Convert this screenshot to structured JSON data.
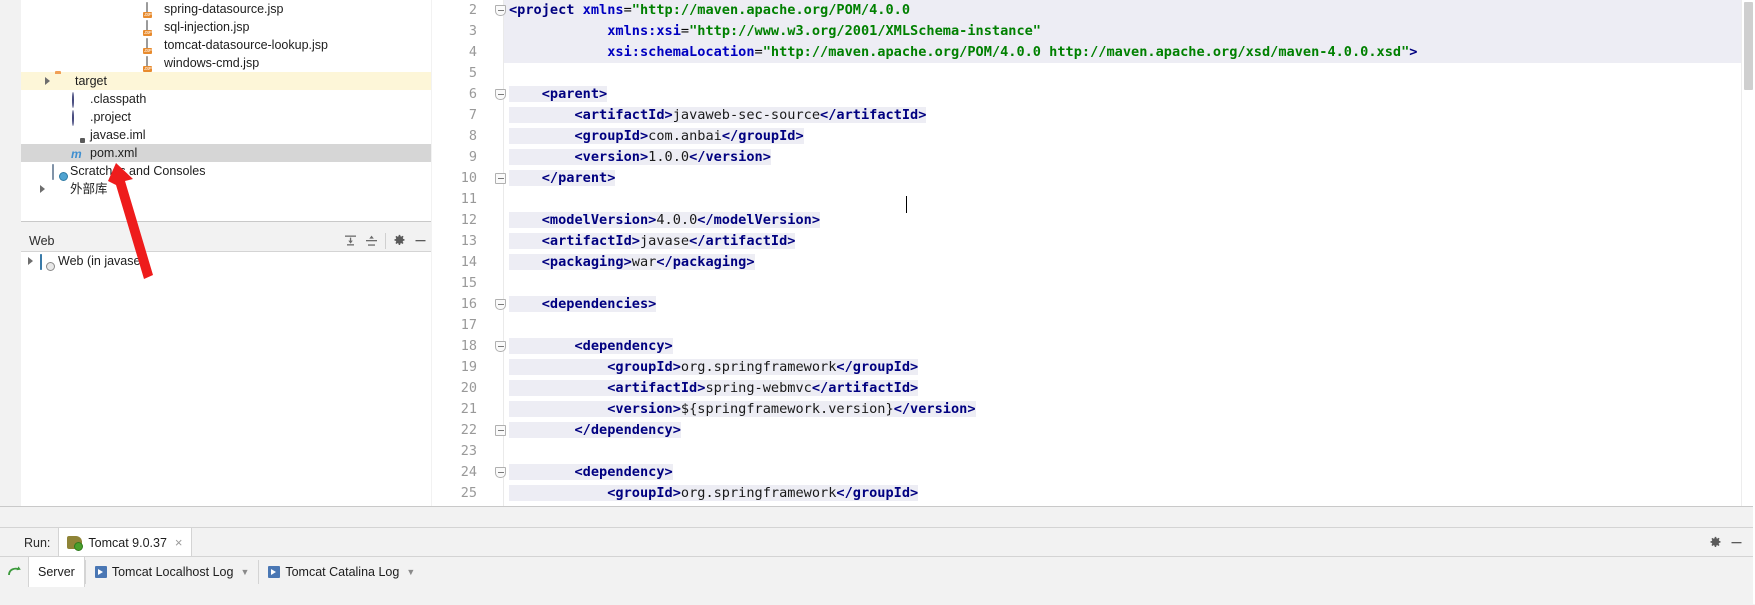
{
  "project_tree": {
    "name": "Project",
    "items": [
      {
        "label": "spring-datasource.jsp",
        "icon": "jsp-file-icon",
        "indent": 110,
        "arrow": false,
        "state": "normal"
      },
      {
        "label": "sql-injection.jsp",
        "icon": "jsp-file-icon",
        "indent": 110,
        "arrow": false,
        "state": "normal"
      },
      {
        "label": "tomcat-datasource-lookup.jsp",
        "icon": "jsp-file-icon",
        "indent": 110,
        "arrow": false,
        "state": "normal"
      },
      {
        "label": "windows-cmd.jsp",
        "icon": "jsp-file-icon",
        "indent": 110,
        "arrow": false,
        "state": "normal"
      },
      {
        "label": "target",
        "icon": "folder-icon",
        "indent": 21,
        "arrow": true,
        "state": "highlight"
      },
      {
        "label": ".classpath",
        "icon": "eclipse-file-icon",
        "indent": 36,
        "arrow": false,
        "state": "normal"
      },
      {
        "label": ".project",
        "icon": "eclipse-file-icon",
        "indent": 36,
        "arrow": false,
        "state": "normal"
      },
      {
        "label": "javase.iml",
        "icon": "module-iml-icon",
        "indent": 36,
        "arrow": false,
        "state": "normal"
      },
      {
        "label": "pom.xml",
        "icon": "maven-m-icon",
        "indent": 36,
        "arrow": false,
        "state": "selected"
      },
      {
        "label": "Scratches and Consoles",
        "icon": "scratches-icon",
        "indent": 16,
        "arrow": false,
        "state": "normal"
      },
      {
        "label": "外部库",
        "icon": "external-libraries-icon",
        "indent": 16,
        "arrow": true,
        "state": "normal"
      }
    ]
  },
  "web_panel": {
    "title": "Web",
    "actions": [
      "expand-all-icon",
      "collapse-all-icon",
      "settings-gear-icon",
      "hide-minimize-icon"
    ],
    "items": [
      {
        "label": "Web (in javase)",
        "icon": "web-module-icon",
        "arrow": true
      }
    ]
  },
  "editor": {
    "file": "pom.xml",
    "first_line_number": 2,
    "lines": [
      {
        "n": 2,
        "fold": "start",
        "selected": true,
        "html": "<span class=\"tag\">&lt;project</span> <span class=\"attr\">xmlns</span>=<span class=\"str\">\"http://maven.apache.org/POM/4.0.0</span>"
      },
      {
        "n": 3,
        "fold": "",
        "selected": true,
        "html": "            <span class=\"attr\">xmlns:xsi</span>=<span class=\"str\">\"http://www.w3.org/2001/XMLSchema-instance\"</span>"
      },
      {
        "n": 4,
        "fold": "",
        "selected": true,
        "html": "            <span class=\"attr\">xsi:schemaLocation</span>=<span class=\"str\">\"http://maven.apache.org/POM/4.0.0 http://maven.apache.org/xsd/maven-4.0.0.xsd\"</span><span class=\"tag\">&gt;</span>"
      },
      {
        "n": 5,
        "fold": "",
        "selected": false,
        "html": ""
      },
      {
        "n": 6,
        "fold": "start",
        "selected": false,
        "html": "    <span class=\"tag\">&lt;parent&gt;</span>"
      },
      {
        "n": 7,
        "fold": "",
        "selected": false,
        "html": "        <span class=\"tag\">&lt;artifactId&gt;</span><span class=\"txt\">javaweb-sec-source</span><span class=\"tag\">&lt;/artifactId&gt;</span>"
      },
      {
        "n": 8,
        "fold": "",
        "selected": false,
        "html": "        <span class=\"tag\">&lt;groupId&gt;</span><span class=\"txt\">com.anbai</span><span class=\"tag\">&lt;/groupId&gt;</span>"
      },
      {
        "n": 9,
        "fold": "",
        "selected": false,
        "html": "        <span class=\"tag\">&lt;version&gt;</span><span class=\"txt\">1.0.0</span><span class=\"tag\">&lt;/version&gt;</span>"
      },
      {
        "n": 10,
        "fold": "end",
        "selected": false,
        "html": "    <span class=\"tag\">&lt;/parent&gt;</span>"
      },
      {
        "n": 11,
        "fold": "",
        "selected": false,
        "html": ""
      },
      {
        "n": 12,
        "fold": "",
        "selected": false,
        "html": "    <span class=\"tag\">&lt;modelVersion&gt;</span><span class=\"txt\">4.0.0</span><span class=\"tag\">&lt;/modelVersion&gt;</span>"
      },
      {
        "n": 13,
        "fold": "",
        "selected": false,
        "html": "    <span class=\"tag\">&lt;artifactId&gt;</span><span class=\"txt\">javase</span><span class=\"tag\">&lt;/artifactId&gt;</span>"
      },
      {
        "n": 14,
        "fold": "",
        "selected": false,
        "html": "    <span class=\"tag\">&lt;packaging&gt;</span><span class=\"txt\">war</span><span class=\"tag\">&lt;/packaging&gt;</span>"
      },
      {
        "n": 15,
        "fold": "",
        "selected": false,
        "html": ""
      },
      {
        "n": 16,
        "fold": "start",
        "selected": false,
        "html": "    <span class=\"tag\">&lt;dependencies&gt;</span>"
      },
      {
        "n": 17,
        "fold": "",
        "selected": false,
        "html": ""
      },
      {
        "n": 18,
        "fold": "start",
        "selected": false,
        "html": "        <span class=\"tag\">&lt;dependency&gt;</span>"
      },
      {
        "n": 19,
        "fold": "",
        "selected": false,
        "html": "            <span class=\"tag\">&lt;groupId&gt;</span><span class=\"txt\">org.springframework</span><span class=\"tag\">&lt;/groupId&gt;</span>"
      },
      {
        "n": 20,
        "fold": "",
        "selected": false,
        "html": "            <span class=\"tag\">&lt;artifactId&gt;</span><span class=\"txt\">spring-webmvc</span><span class=\"tag\">&lt;/artifactId&gt;</span>"
      },
      {
        "n": 21,
        "fold": "",
        "selected": false,
        "html": "            <span class=\"tag\">&lt;version&gt;</span><span class=\"txt\">${springframework.version}</span><span class=\"tag\">&lt;/version&gt;</span>"
      },
      {
        "n": 22,
        "fold": "end",
        "selected": false,
        "html": "        <span class=\"tag\">&lt;/dependency&gt;</span>"
      },
      {
        "n": 23,
        "fold": "",
        "selected": false,
        "html": ""
      },
      {
        "n": 24,
        "fold": "start",
        "selected": false,
        "html": "        <span class=\"tag\">&lt;dependency&gt;</span>"
      },
      {
        "n": 25,
        "fold": "",
        "selected": false,
        "html": "            <span class=\"tag\">&lt;groupId&gt;</span><span class=\"txt\">org.springframework</span><span class=\"tag\">&lt;/groupId&gt;</span>"
      }
    ]
  },
  "run_panel": {
    "run_label": "Run:",
    "tab_label": "Tomcat 9.0.37",
    "close_label": "×",
    "actions": [
      "settings-gear-icon",
      "hide-minimize-icon"
    ],
    "sub_tabs": [
      {
        "label": "Server",
        "icon": null,
        "active": true,
        "chevron": false
      },
      {
        "label": "Tomcat Localhost Log",
        "icon": "log-icon",
        "active": false,
        "chevron": true
      },
      {
        "label": "Tomcat Catalina Log",
        "icon": "log-icon",
        "active": false,
        "chevron": true
      }
    ]
  },
  "colors": {
    "selection_row": "#d6d6d6",
    "highlight_row": "#fdf6d8",
    "code_selection": "#ededf4",
    "tag": "#000080",
    "attribute": "#0000c0",
    "string": "#008000",
    "annotation_arrow": "#ee1c1c",
    "panel_background": "#f2f2f2"
  }
}
